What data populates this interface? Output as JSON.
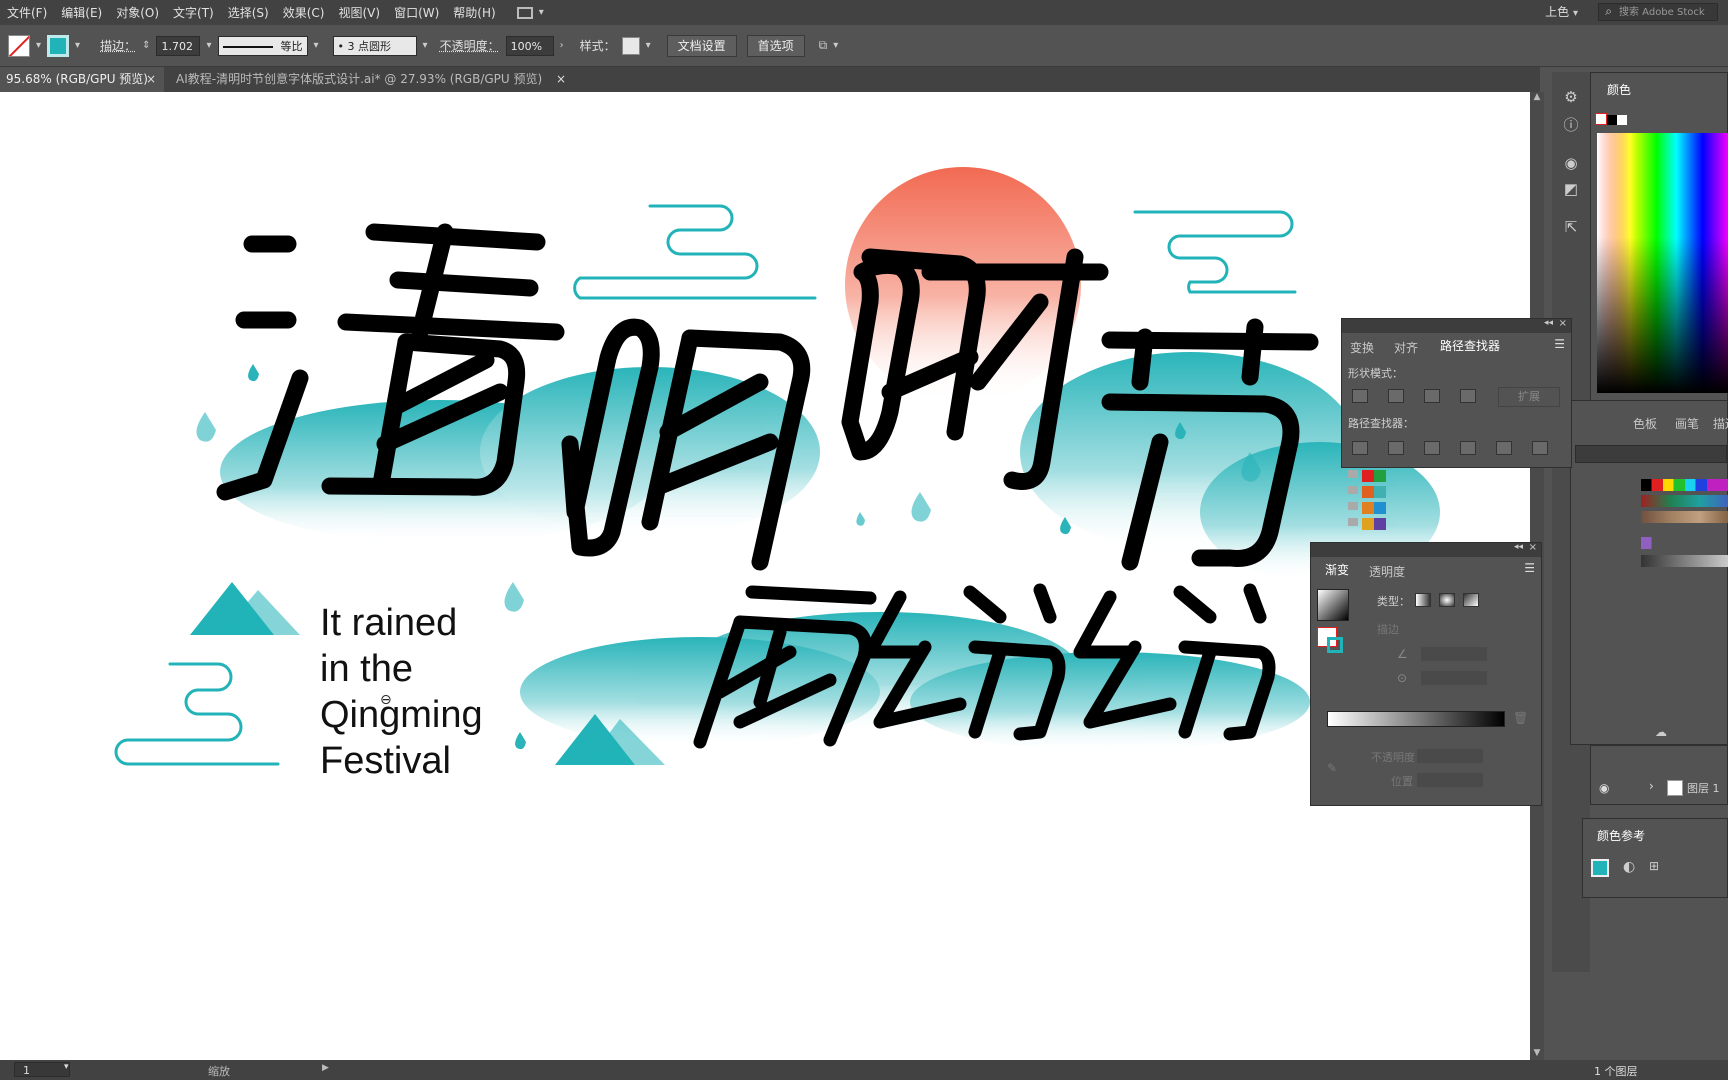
{
  "menu": {
    "items": [
      "文件(F)",
      "编辑(E)",
      "对象(O)",
      "文字(T)",
      "选择(S)",
      "效果(C)",
      "视图(V)",
      "窗口(W)",
      "帮助(H)"
    ],
    "workspace": "上色",
    "search_placeholder": "搜索 Adobe Stock"
  },
  "control_bar": {
    "stroke_label": "描边：",
    "stroke_value": "1.702",
    "profile_label": "等比",
    "brush_label": "3 点圆形",
    "opacity_label": "不透明度：",
    "opacity_value": "100%",
    "style_label": "样式：",
    "doc_setup_button": "文档设置",
    "prefs_button": "首选项"
  },
  "tabs": [
    {
      "label": "95.68% (RGB/GPU 预览)"
    },
    {
      "label": "AI教程-清明时节创意字体版式设计.ai* @ 27.93% (RGB/GPU 预览)"
    }
  ],
  "artwork": {
    "english_lines": [
      "It rained",
      "in the",
      "Qingming",
      "Festival"
    ]
  },
  "panels": {
    "color": {
      "title": "颜色"
    },
    "pathfinder": {
      "tabs": [
        "变换",
        "对齐",
        "路径查找器"
      ],
      "shape_modes_label": "形状模式：",
      "expand_label": "扩展",
      "pathfinders_label": "路径查找器："
    },
    "swatches_tabs": [
      "色板",
      "画笔",
      "描边"
    ],
    "gradient": {
      "tabs": [
        "渐变",
        "透明度"
      ],
      "type_label": "类型：",
      "stroke_label": "描边",
      "opacity_label": "不透明度",
      "location_label": "位置"
    },
    "layers": {
      "layer_name": "图层 1"
    },
    "color_guide": {
      "title": "颜色参考"
    }
  },
  "status": {
    "artboard": "1",
    "zoom_label": "缩放",
    "layers_count": "1 个图层"
  },
  "colors": {
    "teal": "#21b3b8",
    "sun_top": "#f26a52",
    "ui_dark": "#424242",
    "ui_mid": "#535353"
  }
}
